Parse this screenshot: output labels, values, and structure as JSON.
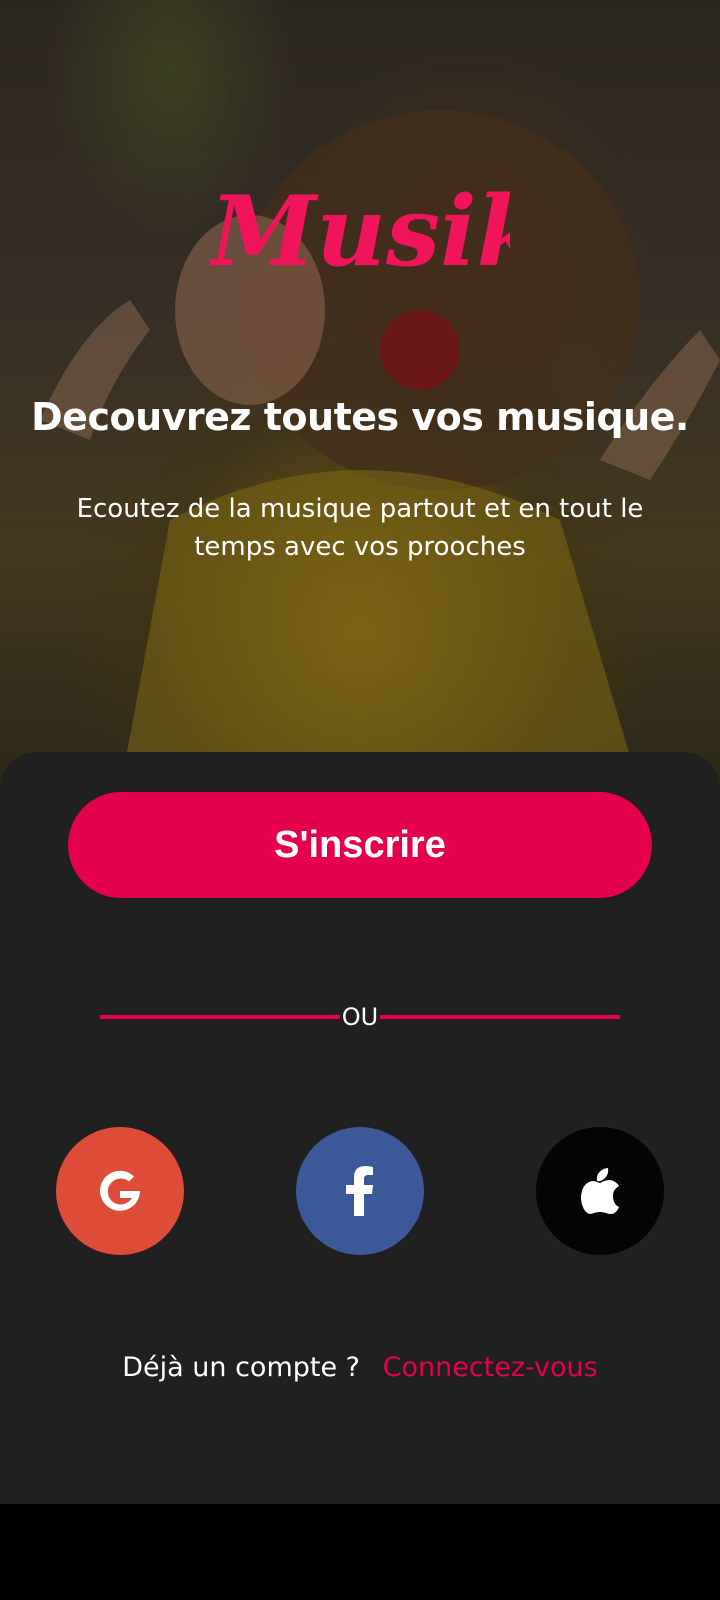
{
  "brand": {
    "logo_text": "Musik",
    "accent": "#e4004b"
  },
  "hero": {
    "headline": "Decouvrez toutes vos musique.",
    "subline": "Ecoutez de la musique partout  et en tout le temps avec vos prooches"
  },
  "actions": {
    "signup_label": "S'inscrire",
    "or_label": "OU"
  },
  "social": [
    {
      "name": "Google",
      "icon": "google-icon",
      "color": "#dd4b39"
    },
    {
      "name": "Facebook",
      "icon": "facebook-icon",
      "color": "#3b5998"
    },
    {
      "name": "Apple",
      "icon": "apple-icon",
      "color": "#050508"
    }
  ],
  "footer": {
    "prompt": "Déjà un compte ?",
    "login_link": "Connectez-vous"
  }
}
